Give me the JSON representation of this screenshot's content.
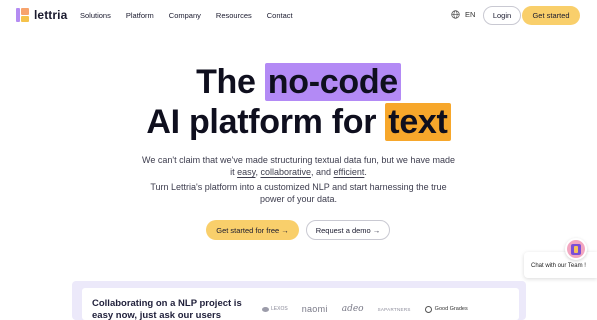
{
  "brand": {
    "name": "lettria"
  },
  "nav": {
    "items": [
      "Solutions",
      "Platform",
      "Company",
      "Resources",
      "Contact"
    ],
    "language": "EN",
    "login_label": "Login",
    "get_started_label": "Get started"
  },
  "hero": {
    "line1_prefix": "The ",
    "line1_highlight": "no-code",
    "line2_prefix": "AI platform for ",
    "line2_highlight": "text",
    "sub1": "We can't claim that we've made structuring textual data fun, but we have made",
    "sub2_prefix": "it ",
    "sub2_easy": "easy",
    "sub2_sep1": ", ",
    "sub2_collab": "collaborative",
    "sub2_sep2": ", and ",
    "sub2_efficient": "efficient",
    "sub2_end": ".",
    "sub3": "Turn Lettria's platform into a customized NLP and start harnessing the true",
    "sub4": "power of your data.",
    "cta_primary": "Get started for free →",
    "cta_secondary": "Request a demo →"
  },
  "collab": {
    "line1": "Collaborating on a NLP project is",
    "line2": "easy now, just ask our users"
  },
  "logos": {
    "l1": "LEXOS",
    "l2": "naomi",
    "l3": "adeo",
    "l4": "SAPARTNERS",
    "l5": "Good Grades"
  },
  "chat": {
    "label": "Chat with our Team !"
  },
  "colors": {
    "accent_yellow": "#f9cf6b",
    "highlight_purple": "#b38af5",
    "highlight_orange": "#f7a72b",
    "band_lavender": "#ece9fa"
  }
}
